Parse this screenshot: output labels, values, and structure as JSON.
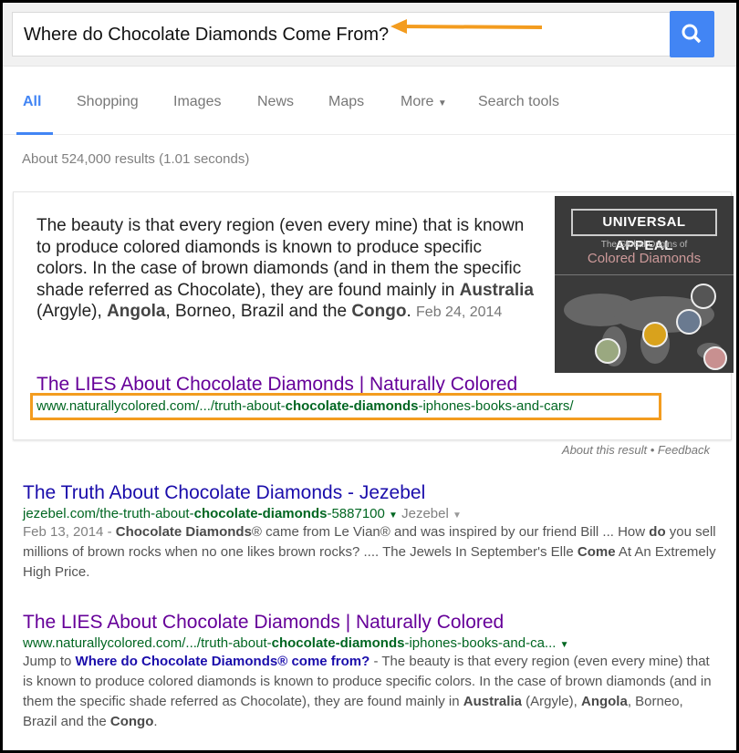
{
  "search": {
    "query": "Where do Chocolate Diamonds Come From?",
    "button": "search-icon",
    "accent": "#4285f4"
  },
  "tabs": [
    "All",
    "Shopping",
    "Images",
    "News",
    "Maps",
    "More",
    "Search tools"
  ],
  "result_count": "About 524,000 results (1.01 seconds)",
  "featured": {
    "s1": "The beauty is that every region (even every mine) that is known to produce colored diamonds is known to produce specific colors. In the case of brown diamonds (and in them the specific shade referred as Chocolate), they are found mainly in ",
    "b1": "Australia",
    "s2": " (Argyle), ",
    "b2": "Angola",
    "s3": ", Borneo, Brazil and the ",
    "b3": "Congo",
    "s4": ". ",
    "date": "Feb 24, 2014",
    "image": {
      "title": "Universal Appeal",
      "subtitle": "The Global Origins of",
      "subtitle2": "Colored Diamonds"
    },
    "title": "The LIES About Chocolate Diamonds | Naturally Colored",
    "url_pre": "www.naturallycolored.com/.../truth-about-",
    "url_bold": "chocolate-diamonds",
    "url_post": "-iphones-books-and-cars/"
  },
  "about": "About this result • Feedback",
  "results": [
    {
      "title": "The Truth About Chocolate Diamonds - Jezebel",
      "url_pre": "jezebel.com/the-truth-about-",
      "url_bold": "chocolate-diamonds",
      "url_post": "-5887100",
      "source": "Jezebel",
      "date": "Feb 13, 2014 - ",
      "b1": "Chocolate Diamonds",
      "t1": "® came from Le Vian® and was inspired by our friend Bill ... How ",
      "b2": "do",
      "t2": " you sell millions of brown rocks when no one likes brown rocks? .... The Jewels In September's Elle ",
      "b3": "Come",
      "t3": " At An Extremely High Price."
    },
    {
      "title": "The LIES About Chocolate Diamonds | Naturally Colored",
      "url_pre": "www.naturallycolored.com/.../truth-about-",
      "url_bold": "chocolate-diamonds",
      "url_post": "-iphones-books-and-ca...",
      "jump": "Jump to ",
      "jump_link": "Where do Chocolate Diamonds® come from?",
      "t1": " - The beauty is that every region (even every mine) that is known to produce colored diamonds is known to produce specific colors. In the case of brown diamonds (and in them the specific shade referred as Chocolate), they are found mainly in ",
      "b1": "Australia",
      "t2": " (Argyle), ",
      "b2": "Angola",
      "t3": ", Borneo, Brazil and the ",
      "b3": "Congo",
      "t4": "."
    }
  ]
}
